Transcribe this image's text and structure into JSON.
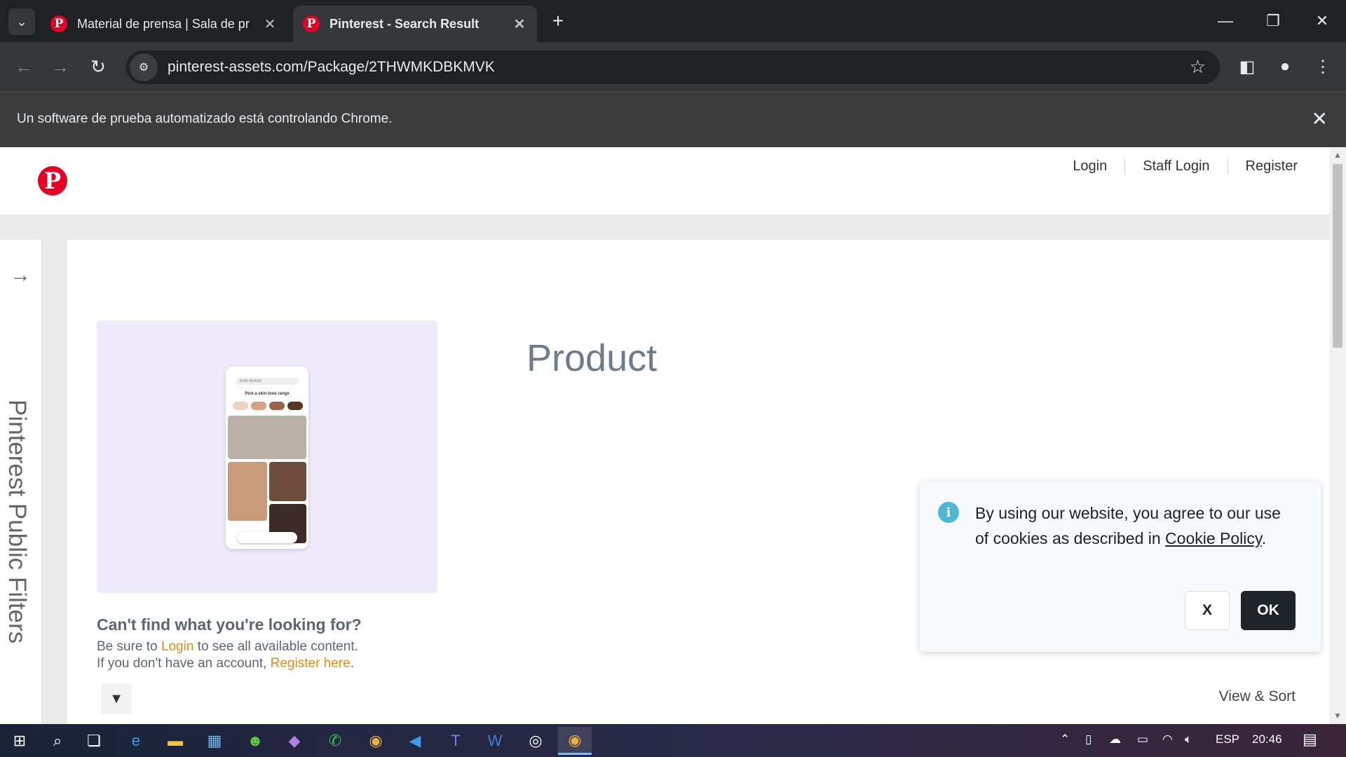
{
  "browser": {
    "tabs": [
      {
        "title": "Material de prensa | Sala de pr",
        "active": false
      },
      {
        "title": "Pinterest - Search Result",
        "active": true
      }
    ],
    "url": "pinterest-assets.com/Package/2THWMKDBKMVK",
    "infobar_text": "Un software de prueba automatizado está controlando Chrome."
  },
  "header": {
    "logo_letter": "P",
    "links": [
      "Login",
      "Staff Login",
      "Register"
    ]
  },
  "sidebar": {
    "label": "Pinterest Public Filters"
  },
  "main": {
    "title": "Product",
    "cant_find": "Can't find what you're looking for?",
    "line1_prefix": "Be sure to ",
    "line1_link": "Login",
    "line1_suffix": " to see all available content.",
    "line2_prefix": "If you don't have an account, ",
    "line2_link": "Register here",
    "line2_suffix": ".",
    "view_sort": "View & Sort",
    "phone": {
      "search_text": "bold lipstick",
      "pick_text": "Pick a skin tone range"
    }
  },
  "cookie": {
    "text_before": "By using our website, you agree to our use of cookies as described in ",
    "link": "Cookie Policy",
    "text_after": ".",
    "dismiss_label": "X",
    "ok_label": "OK"
  },
  "taskbar": {
    "language": "ESP",
    "time": "20:46"
  },
  "colors": {
    "pinterest_red": "#e60023",
    "link_orange": "#e88a1a",
    "card_bg": "#efeafb"
  }
}
